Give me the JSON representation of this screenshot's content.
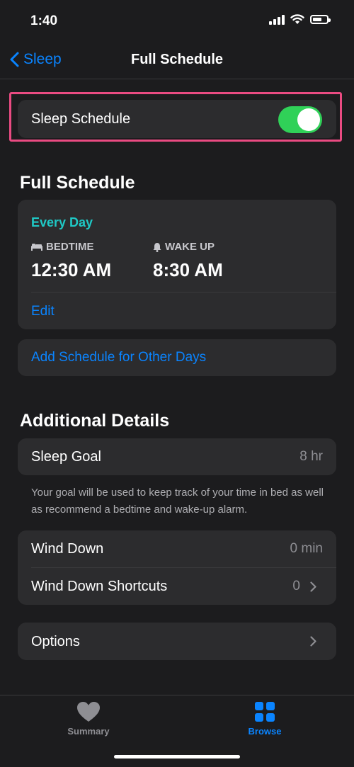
{
  "status": {
    "time": "1:40"
  },
  "nav": {
    "back_label": "Sleep",
    "title": "Full Schedule"
  },
  "sleep_schedule": {
    "label": "Sleep Schedule",
    "enabled": true
  },
  "full_schedule": {
    "section_title": "Full Schedule",
    "days": "Every Day",
    "bedtime_label": "BEDTIME",
    "bedtime_value": "12:30 AM",
    "wakeup_label": "WAKE UP",
    "wakeup_value": "8:30 AM",
    "edit_label": "Edit",
    "add_label": "Add Schedule for Other Days"
  },
  "additional": {
    "section_title": "Additional Details",
    "sleep_goal_label": "Sleep Goal",
    "sleep_goal_value": "8 hr",
    "footnote": "Your goal will be used to keep track of your time in bed as well as recommend a bedtime and wake-up alarm.",
    "wind_down_label": "Wind Down",
    "wind_down_value": "0 min",
    "shortcuts_label": "Wind Down Shortcuts",
    "shortcuts_value": "0",
    "options_label": "Options"
  },
  "tabs": [
    {
      "label": "Summary",
      "icon": "heart-icon",
      "active": false
    },
    {
      "label": "Browse",
      "icon": "grid-icon",
      "active": true
    }
  ],
  "colors": {
    "accent": "#0a84ff",
    "toggle_on": "#30d158",
    "days": "#1fc9c6",
    "highlight": "#ea4b82"
  }
}
